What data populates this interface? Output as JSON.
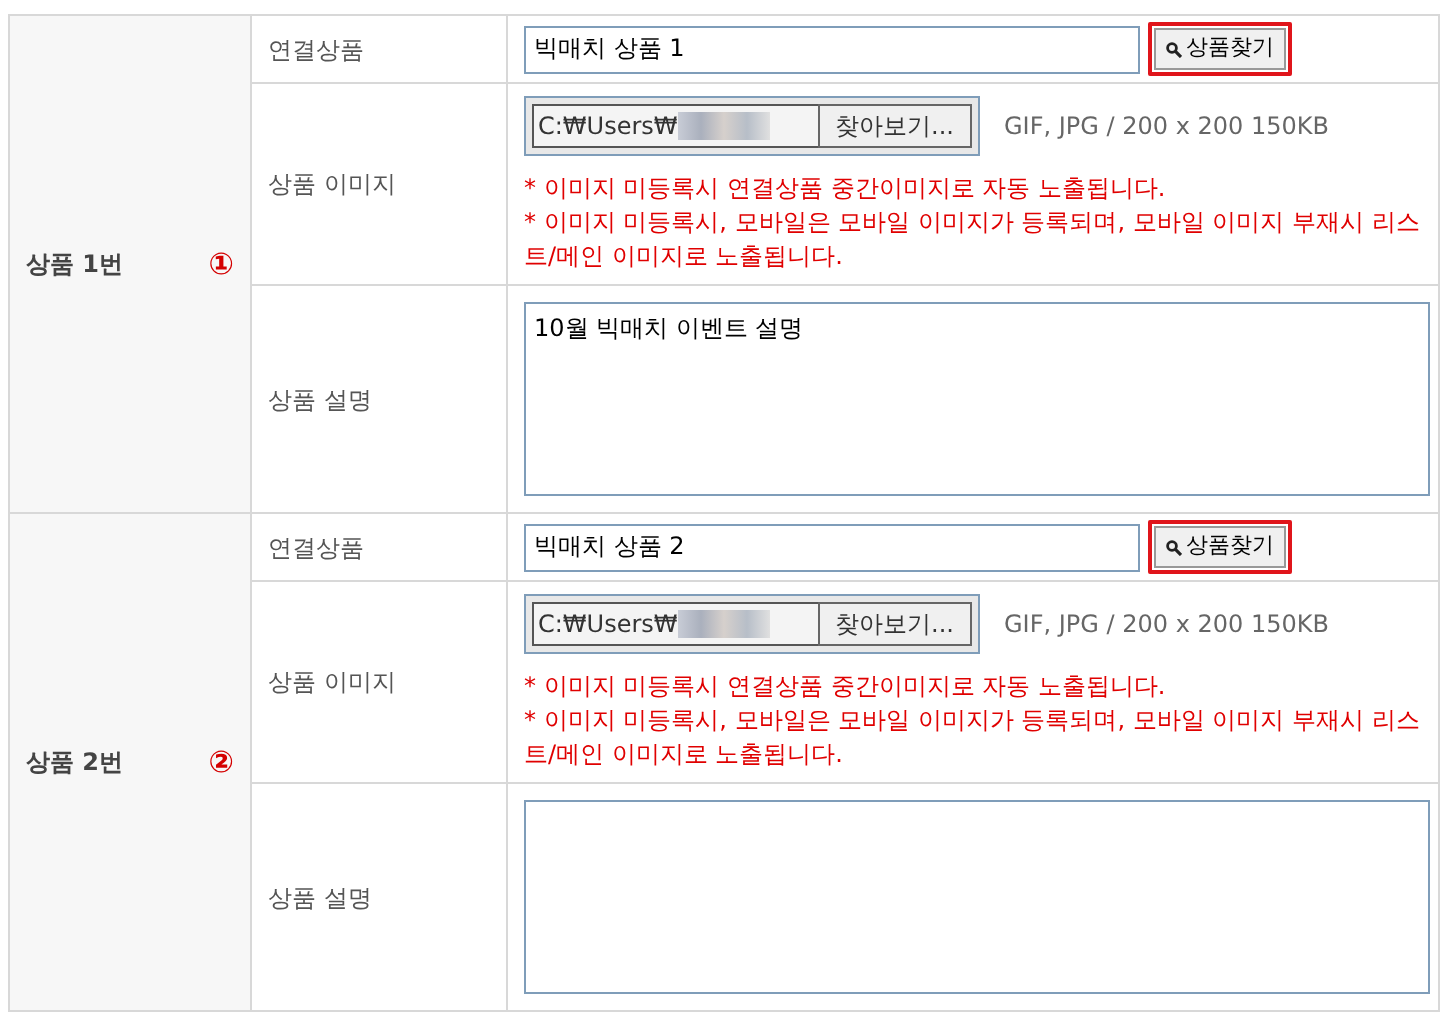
{
  "products": [
    {
      "label": "상품 1번",
      "number": "①",
      "linked_label": "연결상품",
      "linked_value": "빅매치 상품 1",
      "search_button": {
        "text": "상품찾기",
        "highlighted": true
      },
      "image_label": "상품 이미지",
      "file_path": "C:₩Users₩",
      "browse_button": "찾아보기...",
      "file_hint": "GIF, JPG / 200 x 200 150KB",
      "notes": [
        "* 이미지 미등록시 연결상품 중간이미지로 자동 노출됩니다.",
        "* 이미지 미등록시, 모바일은 모바일 이미지가 등록되며, 모바일 이미지 부재시 리스트/메인 이미지로 노출됩니다."
      ],
      "desc_label": "상품 설명",
      "description": "10월 빅매치 이벤트 설명"
    },
    {
      "label": "상품 2번",
      "number": "②",
      "linked_label": "연결상품",
      "linked_value": "빅매치 상품 2",
      "search_button": {
        "text": "상품찾기",
        "highlighted": true
      },
      "image_label": "상품 이미지",
      "file_path": "C:₩Users₩",
      "browse_button": "찾아보기...",
      "file_hint": "GIF, JPG / 200 x 200 150KB",
      "notes": [
        "* 이미지 미등록시 연결상품 중간이미지로 자동 노출됩니다.",
        "* 이미지 미등록시, 모바일은 모바일 이미지가 등록되며, 모바일 이미지 부재시 리스트/메인 이미지로 노출됩니다."
      ],
      "desc_label": "상품 설명"
    }
  ]
}
